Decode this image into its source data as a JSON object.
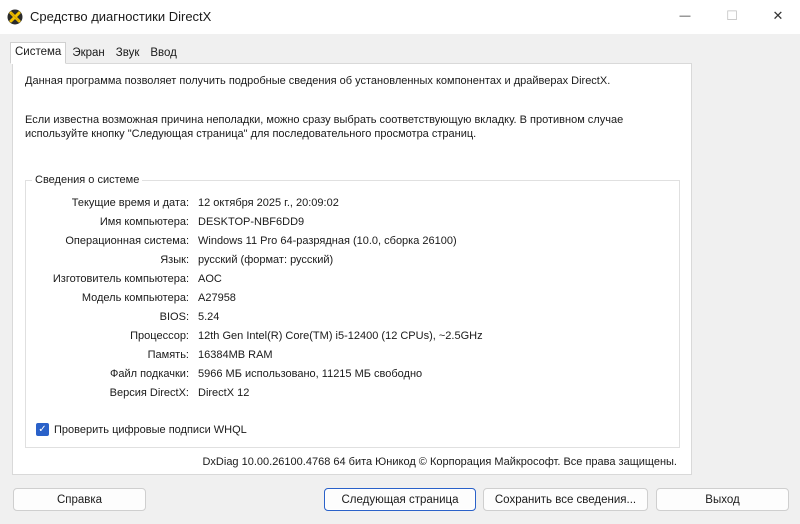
{
  "window": {
    "title": "Средство диагностики DirectX",
    "controls": {
      "minimize": "—",
      "maximize": "☐",
      "close": "✕"
    }
  },
  "tabs": [
    {
      "label": "Система",
      "active": true
    },
    {
      "label": "Экран",
      "active": false
    },
    {
      "label": "Звук",
      "active": false
    },
    {
      "label": "Ввод",
      "active": false
    }
  ],
  "intro": {
    "line1": "Данная программа позволяет получить подробные сведения об установленных компонентах и драйверах DirectX.",
    "line2": "Если известна возможная причина неполадки, можно сразу выбрать соответствующую вкладку. В противном случае используйте кнопку \"Следующая страница\" для последовательного просмотра страниц."
  },
  "system_info": {
    "title": "Сведения о системе",
    "rows": [
      {
        "label": "Текущие время и дата:",
        "value": "12 октября 2025 г., 20:09:02"
      },
      {
        "label": "Имя компьютера:",
        "value": "DESKTOP-NBF6DD9"
      },
      {
        "label": "Операционная система:",
        "value": "Windows 11 Pro 64-разрядная (10.0, сборка 26100)"
      },
      {
        "label": "Язык:",
        "value": "русский (формат: русский)"
      },
      {
        "label": "Изготовитель компьютера:",
        "value": "AOC"
      },
      {
        "label": "Модель компьютера:",
        "value": "A27958"
      },
      {
        "label": "BIOS:",
        "value": "5.24"
      },
      {
        "label": "Процессор:",
        "value": "12th Gen Intel(R) Core(TM) i5-12400 (12 CPUs), ~2.5GHz"
      },
      {
        "label": "Память:",
        "value": "16384MB RAM"
      },
      {
        "label": "Файл подкачки:",
        "value": "5966 МБ использовано, 11215 МБ свободно"
      },
      {
        "label": "Версия DirectX:",
        "value": "DirectX 12"
      }
    ]
  },
  "whql": {
    "label": "Проверить цифровые подписи WHQL",
    "checked": true,
    "check_glyph": "✓"
  },
  "footer": "DxDiag 10.00.26100.4768 64 бита Юникод © Корпорация Майкрософт. Все права защищены.",
  "buttons": {
    "help": "Справка",
    "next": "Следующая страница",
    "save": "Сохранить все сведения...",
    "exit": "Выход"
  },
  "colors": {
    "accent": "#2a61c9",
    "panel_bg": "#ffffff",
    "window_bg": "#f0f0f0"
  },
  "icons": {
    "app": "directx-icon"
  }
}
